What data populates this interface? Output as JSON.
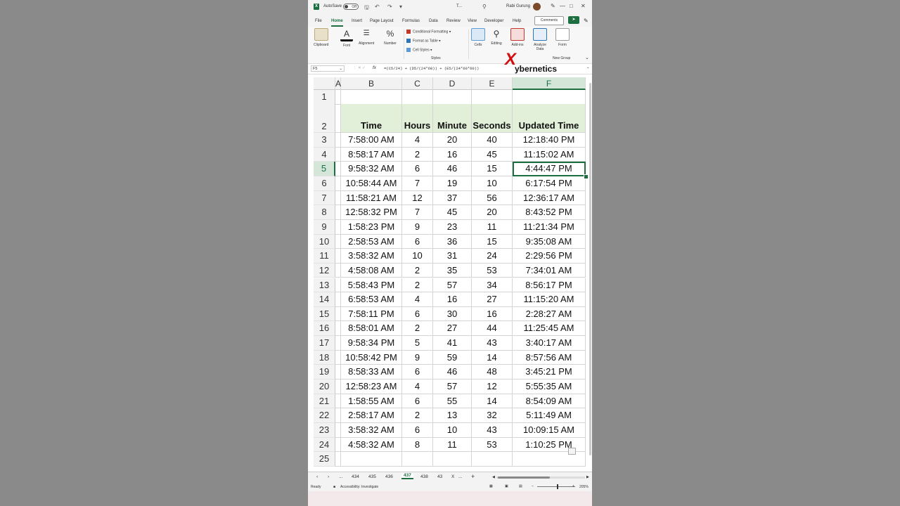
{
  "titlebar": {
    "autosave_label": "AutoSave",
    "autosave_state": "Off",
    "file_title": "T...",
    "user_name": "Rabi Gurung",
    "save_icon": "save-icon",
    "undo_icon": "undo-icon",
    "redo_icon": "redo-icon"
  },
  "menu": {
    "items": [
      "File",
      "Home",
      "Insert",
      "Page Layout",
      "Formulas",
      "Data",
      "Review",
      "View",
      "Developer",
      "Help"
    ],
    "active": "Home",
    "comments_label": "Comments"
  },
  "ribbon": {
    "clipboard": "Clipboard",
    "font": "Font",
    "alignment": "Alignment",
    "number": "Number",
    "conditional_formatting": "Conditional Formatting",
    "format_as_table": "Format as Table",
    "cell_styles": "Cell Styles",
    "styles": "Styles",
    "cells": "Cells",
    "editing": "Editing",
    "addins": "Add-ins",
    "analyze_data": "Analyze Data",
    "form": "Form",
    "new_group": "New Group"
  },
  "formula_bar": {
    "name_box": "F5",
    "fx": "fx",
    "formula": "=(C5/24) + (D5/(24*60)) + (E5/(24*60*60))"
  },
  "brand": {
    "mark": "X",
    "text": "ybernetics",
    "color": "#d10d0d"
  },
  "grid": {
    "columns": [
      "A",
      "B",
      "C",
      "D",
      "E",
      "F"
    ],
    "selected_column": "F",
    "selected_row": "5",
    "headers": [
      "Time",
      "Hours",
      "Minute",
      "Seconds",
      "Updated Time"
    ],
    "header_fill": "#e2f0d9",
    "rows": [
      [
        "3",
        "7:58:00 AM",
        "4",
        "20",
        "40",
        "12:18:40 PM"
      ],
      [
        "4",
        "8:58:17 AM",
        "2",
        "16",
        "45",
        "11:15:02 AM"
      ],
      [
        "5",
        "9:58:32 AM",
        "6",
        "46",
        "15",
        "4:44:47 PM"
      ],
      [
        "6",
        "10:58:44 AM",
        "7",
        "19",
        "10",
        "6:17:54 PM"
      ],
      [
        "7",
        "11:58:21 AM",
        "12",
        "37",
        "56",
        "12:36:17 AM"
      ],
      [
        "8",
        "12:58:32 PM",
        "7",
        "45",
        "20",
        "8:43:52 PM"
      ],
      [
        "9",
        "1:58:23 PM",
        "9",
        "23",
        "11",
        "11:21:34 PM"
      ],
      [
        "10",
        "2:58:53 AM",
        "6",
        "36",
        "15",
        "9:35:08 AM"
      ],
      [
        "11",
        "3:58:32 AM",
        "10",
        "31",
        "24",
        "2:29:56 PM"
      ],
      [
        "12",
        "4:58:08 AM",
        "2",
        "35",
        "53",
        "7:34:01 AM"
      ],
      [
        "13",
        "5:58:43 PM",
        "2",
        "57",
        "34",
        "8:56:17 PM"
      ],
      [
        "14",
        "6:58:53 AM",
        "4",
        "16",
        "27",
        "11:15:20 AM"
      ],
      [
        "15",
        "7:58:11 PM",
        "6",
        "30",
        "16",
        "2:28:27 AM"
      ],
      [
        "16",
        "8:58:01 AM",
        "2",
        "27",
        "44",
        "11:25:45 AM"
      ],
      [
        "17",
        "9:58:34 PM",
        "5",
        "41",
        "43",
        "3:40:17 AM"
      ],
      [
        "18",
        "10:58:42 PM",
        "9",
        "59",
        "14",
        "8:57:56 AM"
      ],
      [
        "19",
        "8:58:33 AM",
        "6",
        "46",
        "48",
        "3:45:21 PM"
      ],
      [
        "20",
        "12:58:23 AM",
        "4",
        "57",
        "12",
        "5:55:35 AM"
      ],
      [
        "21",
        "1:58:55 AM",
        "6",
        "55",
        "14",
        "8:54:09 AM"
      ],
      [
        "22",
        "2:58:17 AM",
        "2",
        "13",
        "32",
        "5:11:49 AM"
      ],
      [
        "23",
        "3:58:32 AM",
        "6",
        "10",
        "43",
        "10:09:15 AM"
      ],
      [
        "24",
        "4:58:32 AM",
        "8",
        "11",
        "53",
        "1:10:25 PM"
      ]
    ],
    "row_labels_top": [
      "1",
      "2"
    ],
    "row_label_last": "25"
  },
  "sheet_tabs": {
    "tabs": [
      "434",
      "435",
      "436",
      "437",
      "438",
      "43",
      "X"
    ],
    "active": "437",
    "more": "...",
    "add": "+"
  },
  "status": {
    "ready": "Ready",
    "accessibility": "Accessibility: Investigate",
    "zoom": "205%"
  }
}
